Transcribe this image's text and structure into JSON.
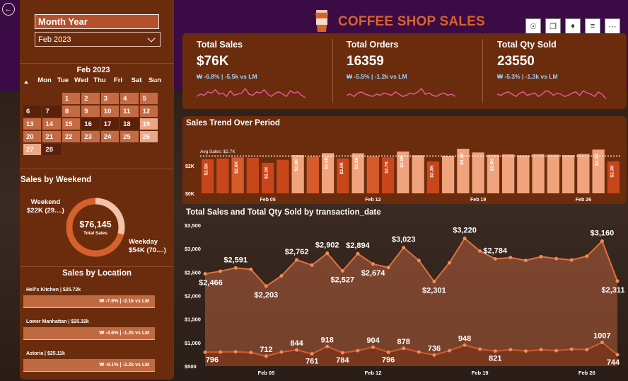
{
  "header": {
    "title": "COFFEE SHOP SALES"
  },
  "filter": {
    "title": "Month Year",
    "selected": "Feb 2023"
  },
  "calendar": {
    "title": "Feb 2023",
    "weekdays": [
      "Mon",
      "Tue",
      "Wed",
      "Thu",
      "Fri",
      "Sat",
      "Sun"
    ],
    "cells": [
      "",
      "",
      "1",
      "2",
      "3",
      "4",
      "5",
      "6",
      "7",
      "8",
      "9",
      "10",
      "11",
      "12",
      "13",
      "14",
      "15",
      "16",
      "17",
      "18",
      "19",
      "20",
      "21",
      "22",
      "23",
      "24",
      "25",
      "26",
      "27",
      "28"
    ],
    "colors": {
      "dark": "#5b200a",
      "mid": "#c46a44",
      "light": "#e9a888"
    }
  },
  "weekend": {
    "title": "Sales by Weekend",
    "total": "$76,145",
    "total_label": "Total Sales",
    "weekend_label": "Weekend",
    "weekend_value": "$22K (29....)",
    "weekday_label": "Weekday",
    "weekday_value": "$54K (70....)",
    "weekend_share": 0.29
  },
  "location": {
    "title": "Sales by Location",
    "items": [
      {
        "name": "Hell's Kitchen | $25.72k",
        "delta": "-7.6% | -2.1k vs LM"
      },
      {
        "name": "Lower Manhattan | $25.32k",
        "delta": "-4.6% | -1.2k vs LM"
      },
      {
        "name": "Astoria | $25.11k",
        "delta": "-8.1% | -2.2k vs LM"
      }
    ]
  },
  "kpis": [
    {
      "title": "Total Sales",
      "value": "$76K",
      "delta": "-6.8% | -5.5k vs LM"
    },
    {
      "title": "Total Orders",
      "value": "16359",
      "delta": "-5.5% | -1.2k vs LM"
    },
    {
      "title": "Total Qty Sold",
      "value": "23550",
      "delta": "-5.3% | -1.3k vs LM"
    }
  ],
  "colors": {
    "panel": "#6b2c0d",
    "accent": "#d8632a",
    "delta": "#9ad5ff",
    "spark": "#e85b9c"
  },
  "trend": {
    "title": "Sales Trend Over Period",
    "avg_label": "Avg Sales: $2.7K"
  },
  "combo": {
    "title": "Total Sales and Total Qty Sold by transaction_date"
  },
  "chart_data": [
    {
      "type": "bar",
      "title": "Sales Trend Over Period",
      "x": [
        "Feb 01",
        "Feb 02",
        "Feb 03",
        "Feb 04",
        "Feb 05",
        "Feb 06",
        "Feb 07",
        "Feb 08",
        "Feb 09",
        "Feb 10",
        "Feb 11",
        "Feb 12",
        "Feb 13",
        "Feb 14",
        "Feb 15",
        "Feb 16",
        "Feb 17",
        "Feb 18",
        "Feb 19",
        "Feb 20",
        "Feb 21",
        "Feb 22",
        "Feb 23",
        "Feb 24",
        "Feb 25",
        "Feb 26",
        "Feb 27",
        "Feb 28"
      ],
      "values": [
        2466,
        2520,
        2591,
        2560,
        2203,
        2420,
        2762,
        2650,
        2902,
        2527,
        2894,
        2674,
        2600,
        3023,
        2750,
        2301,
        2700,
        3220,
        2950,
        2784,
        2810,
        2750,
        2830,
        2790,
        2760,
        2840,
        3160,
        2311
      ],
      "bar_labels": [
        "$2.5K",
        "",
        "$2.6K",
        "",
        "$2.2K",
        "",
        "$2.8K",
        "",
        "$2.9K",
        "$2.5K",
        "$2.9K",
        "",
        "$2.7K",
        "$3.0K",
        "",
        "$2.3K",
        "",
        "$3.2K",
        "",
        "$2.8K",
        "",
        "",
        "",
        "",
        "",
        "",
        "$3.2K",
        "$2.3K"
      ],
      "x_ticks": [
        "Feb 05",
        "Feb 12",
        "Feb 19",
        "Feb 26"
      ],
      "y_ticks": [
        "$0K",
        "$2K"
      ],
      "avg": 2700,
      "avg_label": "Avg Sales: $2.7K",
      "ylim": [
        0,
        3500
      ]
    },
    {
      "type": "area",
      "title": "Total Sales and Total Qty Sold by transaction_date",
      "x": [
        "Feb 01",
        "Feb 02",
        "Feb 03",
        "Feb 04",
        "Feb 05",
        "Feb 06",
        "Feb 07",
        "Feb 08",
        "Feb 09",
        "Feb 10",
        "Feb 11",
        "Feb 12",
        "Feb 13",
        "Feb 14",
        "Feb 15",
        "Feb 16",
        "Feb 17",
        "Feb 18",
        "Feb 19",
        "Feb 20",
        "Feb 21",
        "Feb 22",
        "Feb 23",
        "Feb 24",
        "Feb 25",
        "Feb 26",
        "Feb 27",
        "Feb 28"
      ],
      "series": [
        {
          "values": [
            2466,
            2520,
            2591,
            2560,
            2203,
            2420,
            2762,
            2650,
            2902,
            2527,
            2894,
            2674,
            2600,
            3023,
            2750,
            2301,
            2700,
            3220,
            2950,
            2784,
            2810,
            2750,
            2830,
            2790,
            2760,
            2840,
            3160,
            2311
          ],
          "labels": [
            "$2,466",
            "",
            "$2,591",
            "",
            "$2,203",
            "",
            "$2,762",
            "",
            "$2,902",
            "$2,527",
            "$2,894",
            "$2,674",
            "",
            "$3,023",
            "",
            "$2,301",
            "",
            "$3,220",
            "",
            "$2,784",
            "",
            "",
            "",
            "",
            "",
            "",
            "$3,160",
            "$2,311"
          ]
        },
        {
          "values": [
            796,
            800,
            805,
            790,
            712,
            800,
            844,
            761,
            918,
            784,
            830,
            904,
            796,
            878,
            800,
            736,
            830,
            948,
            860,
            821,
            850,
            820,
            850,
            830,
            860,
            850,
            1007,
            744
          ],
          "labels": [
            "796",
            "",
            "",
            "",
            "712",
            "",
            "844",
            "761",
            "918",
            "784",
            "",
            "904",
            "796",
            "878",
            "",
            "736",
            "",
            "948",
            "",
            "821",
            "",
            "",
            "",
            "",
            "",
            "",
            "1007",
            "744"
          ]
        }
      ],
      "x_ticks": [
        "Feb 05",
        "Feb 12",
        "Feb 19",
        "Feb 26"
      ],
      "y_ticks": [
        "$500",
        "$1,000",
        "$1,500",
        "$2,000",
        "$2,500",
        "$3,000",
        "$3,500"
      ],
      "ylim": [
        500,
        3500
      ]
    }
  ]
}
